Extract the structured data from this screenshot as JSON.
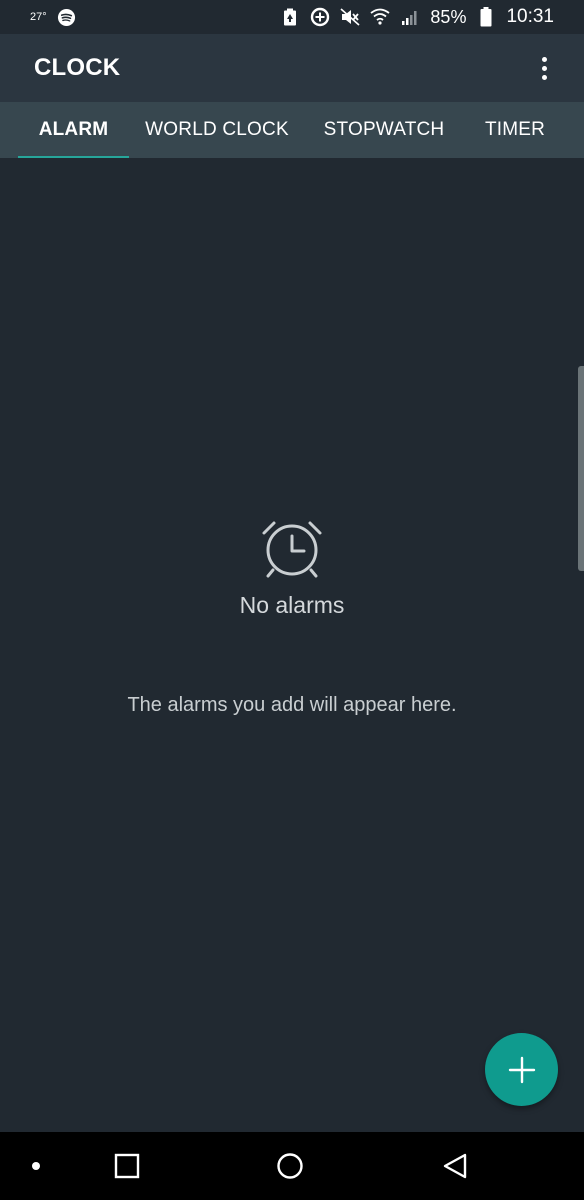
{
  "status_bar": {
    "temperature": "27°",
    "battery_percent": "85%",
    "time": "10:31",
    "icons": [
      "spotify-icon",
      "battery-saver-icon",
      "data-saver-icon",
      "mute-icon",
      "wifi-icon",
      "signal-icon",
      "battery-icon"
    ]
  },
  "app_bar": {
    "title": "CLOCK",
    "overflow_icon": "more-vert-icon"
  },
  "tabs": [
    {
      "label": "ALARM",
      "active": true
    },
    {
      "label": "WORLD CLOCK",
      "active": false
    },
    {
      "label": "STOPWATCH",
      "active": false
    },
    {
      "label": "TIMER",
      "active": false
    }
  ],
  "empty_state": {
    "icon": "alarm-clock-icon",
    "title": "No alarms",
    "description": "The alarms you add will appear here."
  },
  "fab": {
    "icon": "add-icon"
  },
  "navigation": {
    "items": [
      "recent-apps-dot-icon",
      "overview-icon",
      "home-icon",
      "back-icon"
    ]
  },
  "colors": {
    "background": "#212931",
    "app_bar": "#2b3640",
    "tab_bar": "#37474f",
    "accent": "#26a69a",
    "fab": "#0f9b8e"
  }
}
